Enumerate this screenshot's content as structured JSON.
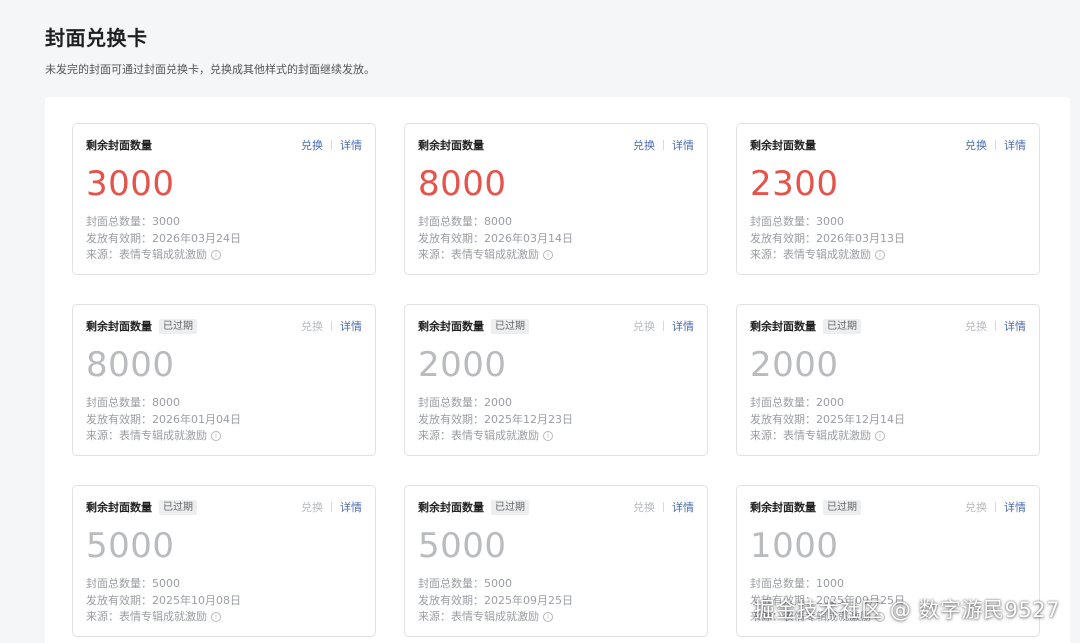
{
  "header": {
    "title": "封面兑换卡",
    "description": "未发完的封面可通过封面兑换卡，兑换成其他样式的封面继续发放。"
  },
  "card_common": {
    "label": "剩余封面数量",
    "expired_tag": "已过期",
    "redeem_label": "兑换",
    "detail_label": "详情",
    "total_prefix": "封面总数量：",
    "validity_prefix": "发放有效期：",
    "source_prefix": "来源：",
    "info_icon": "info-circle-icon"
  },
  "colors": {
    "count_active": "#e5534b",
    "count_expired": "#b9bbbf",
    "link": "#4a6cb0"
  },
  "cards": [
    {
      "remaining": "3000",
      "total": "3000",
      "validity": "2026年03月24日",
      "source": "表情专辑成就激励",
      "expired": false
    },
    {
      "remaining": "8000",
      "total": "8000",
      "validity": "2026年03月14日",
      "source": "表情专辑成就激励",
      "expired": false
    },
    {
      "remaining": "2300",
      "total": "3000",
      "validity": "2026年03月13日",
      "source": "表情专辑成就激励",
      "expired": false
    },
    {
      "remaining": "8000",
      "total": "8000",
      "validity": "2026年01月04日",
      "source": "表情专辑成就激励",
      "expired": true
    },
    {
      "remaining": "2000",
      "total": "2000",
      "validity": "2025年12月23日",
      "source": "表情专辑成就激励",
      "expired": true
    },
    {
      "remaining": "2000",
      "total": "2000",
      "validity": "2025年12月14日",
      "source": "表情专辑成就激励",
      "expired": true
    },
    {
      "remaining": "5000",
      "total": "5000",
      "validity": "2025年10月08日",
      "source": "表情专辑成就激励",
      "expired": true
    },
    {
      "remaining": "5000",
      "total": "5000",
      "validity": "2025年09月25日",
      "source": "表情专辑成就激励",
      "expired": true
    },
    {
      "remaining": "1000",
      "total": "1000",
      "validity": "2025年09月25日",
      "source": "表情专辑成就激励",
      "expired": true
    }
  ],
  "watermark": "掘金技术社区 @ 数字游民9527"
}
